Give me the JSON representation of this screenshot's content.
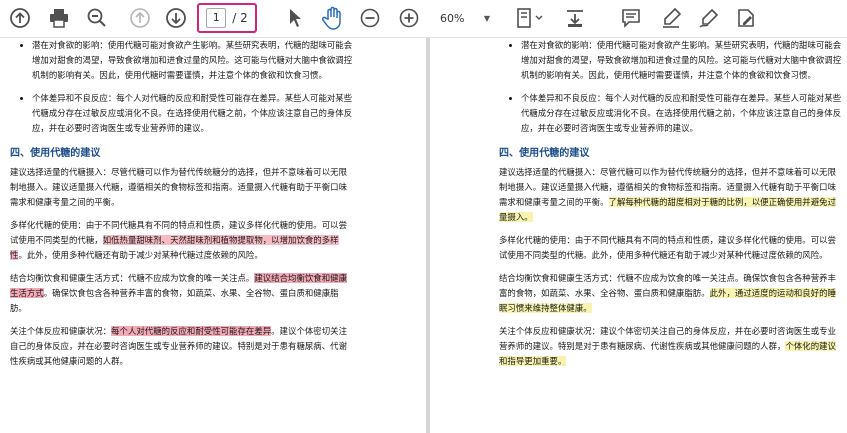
{
  "toolbar": {
    "page_current": "1",
    "page_total": "/ 2",
    "zoom": "60%",
    "icons": [
      "upload-icon",
      "print-icon",
      "search-icon",
      "page-up-icon",
      "page-down-icon",
      "cursor-icon",
      "hand-icon",
      "zoom-out-icon",
      "zoom-in-icon",
      "page-fit-icon",
      "scroll-icon",
      "comment-icon",
      "highlight-icon",
      "sign-icon",
      "edit-icon"
    ]
  },
  "colors": {
    "accent": "#d0267a",
    "heading": "#1f4e8c",
    "red_highlight": "#f6bcc5",
    "yellow_highlight": "#f7f3b0"
  },
  "left": {
    "bullet1": "潜在对食欲的影响：使用代糖可能对食欲产生影响。某些研究表明，代糖的甜味可能会增加对甜食的渴望，导致食欲增加和进食过量的风险。这可能与代糖对大脑中食欲调控机制的影响有关。因此，使用代糖时需要谨慎，并注意个体的食欲和饮食习惯。",
    "bullet2": "个体差异和不良反应：每个人对代糖的反应和耐受性可能存在差异。某些人可能对某些代糖成分存在过敏反应或消化不良。在选择使用代糖之前，个体应该注意自己的身体反应，并在必要时咨询医生或专业营养师的建议。",
    "heading": "四、使用代糖的建议",
    "p1": "建议选择适量的代糖摄入：尽管代糖可以作为替代传统糖分的选择，但并不意味着可以无限制地摄入。建议适量摄入代糖，遵循相关的食物标签和指南。适量摄入代糖有助于平衡口味需求和健康考量之间的平衡。",
    "p2_a": "多样化代糖的使用：由于不同代糖具有不同的特点和性质，建议多样化代糖的使用。可以尝试使用不同类型的代糖，",
    "p2_hl": "如低热量甜味剂、天然甜味剂和植物提取物，以增加饮食的多样性",
    "p2_b": "。此外，使用多种代糖还有助于减少对某种代糖过度依赖的风险。",
    "p3_a": "结合均衡饮食和健康生活方式：代糖不应成为饮食的唯一关注点。",
    "p3_hl": "建议结合均衡饮食和健康生活方式",
    "p3_b": "。确保饮食包含各种营养丰富的食物，如蔬菜、水果、全谷物、蛋白质和健康脂肪。",
    "p4_a": "关注个体反应和健康状况：",
    "p4_hl": "每个人对代糖的反应和耐受性可能存在差异",
    "p4_b": "。建议个体密切关注自己的身体反应，并在必要时咨询医生或专业营养师的建议。特别是对于患有糖尿病、代谢性疾病或其他健康问题的人群。"
  },
  "right": {
    "bullet1": "潜在对食欲的影响：使用代糖可能对食欲产生影响。某些研究表明，代糖的甜味可能会增加对甜食的渴望，导致食欲增加和进食过量的风险。这可能与代糖对大脑中食欲调控机制的影响有关。因此，使用代糖时需要谨慎，并注意个体的食欲和饮食习惯。",
    "bullet2": "个体差异和不良反应：每个人对代糖的反应和耐受性可能存在差异。某些人可能对某些代糖成分存在过敏反应或消化不良。在选择使用代糖之前，个体应该注意自己的身体反应，并在必要时咨询医生或专业营养师的建议。",
    "heading": "四、使用代糖的建议",
    "p1_a": "建议选择适量的代糖摄入：尽管代糖可以作为替代传统糖分的选择，但并不意味着可以无限制地摄入。建议适量摄入代糖，遵循相关的食物标签和指南。适量摄入代糖有助于平衡口味需求和健康考量之间的平衡。",
    "p1_hl": "了解每种代糖的甜度相对于糖的比例，以便正确使用并避免过量摄入。",
    "p2": "多样化代糖的使用：由于不同代糖具有不同的特点和性质，建议多样化代糖的使用。可以尝试使用不同类型的代糖。此外，使用多种代糖还有助于减少对某种代糖过度依赖的风险。",
    "p3_a": "结合均衡饮食和健康生活方式：代糖不应成为饮食的唯一关注点。确保饮食包含各种营养丰富的食物，如蔬菜、水果、全谷物、蛋白质和健康脂肪。",
    "p3_hl": "此外，通过适度的运动和良好的睡眠习惯来维持整体健康。",
    "p4_a": "关注个体反应和健康状况：建议个体密切关注自己的身体反应，并在必要时咨询医生或专业营养师的建议。特别是对于患有糖尿病、代谢性疾病或其他健康问题的人群，",
    "p4_hl": "个体化的建议和指导更加重要。"
  }
}
